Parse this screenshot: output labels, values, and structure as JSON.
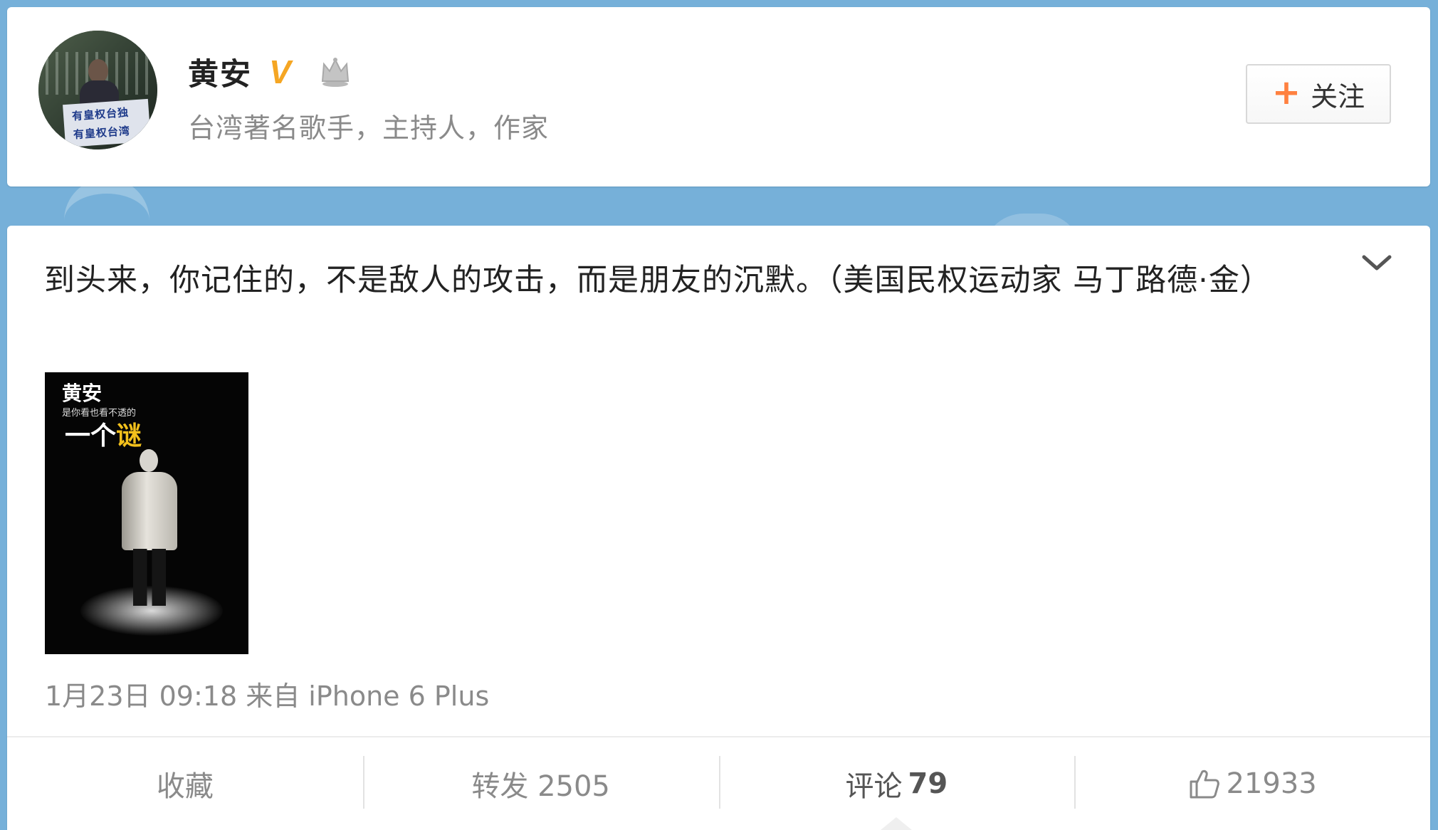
{
  "user": {
    "name": "黄安",
    "verified_badge": "V",
    "description": "台湾著名歌手，主持人，作家",
    "avatar_sign_text": [
      "有皇权台独",
      "有皇权台湾"
    ],
    "follow_label": "关注",
    "follow_icon": "+"
  },
  "post": {
    "text": "到头来，你记住的，不是敌人的攻击，而是朋友的沉默。（美国民权运动家 马丁路德·金）",
    "image": {
      "title": "黄安",
      "subtitle": "是你看也看不透的",
      "caption_prefix": "一个",
      "caption_highlight": "谜"
    },
    "meta": "1月23日 09:18 来自 iPhone 6 Plus"
  },
  "actions": {
    "favorite_label": "收藏",
    "repost_label": "转发 2505",
    "comment_label": "评论",
    "comment_count": "79",
    "like_count": "21933"
  },
  "colors": {
    "background": "#76b0d9",
    "accent_orange": "#ff8140",
    "verified_gold": "#f5a623"
  }
}
